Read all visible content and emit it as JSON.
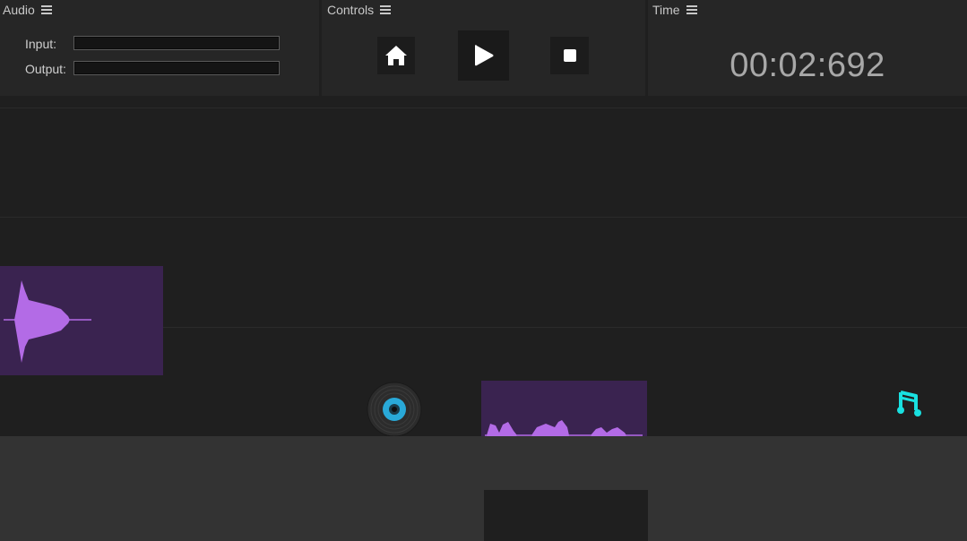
{
  "audio_panel": {
    "title": "Audio",
    "input_label": "Input:",
    "output_label": "Output:",
    "input_level": 0,
    "output_level": 0
  },
  "controls_panel": {
    "title": "Controls",
    "home_icon": "home-icon",
    "play_icon": "play-icon",
    "stop_icon": "stop-icon"
  },
  "time_panel": {
    "title": "Time",
    "value": "00:02:692"
  },
  "icons": {
    "disc": "vinyl-disc-icon",
    "note": "music-note-icon"
  },
  "colors": {
    "clip_bg": "#3a2350",
    "waveform": "#b36be6",
    "note_accent": "#19e0e0",
    "disc_center": "#29a9d8"
  }
}
